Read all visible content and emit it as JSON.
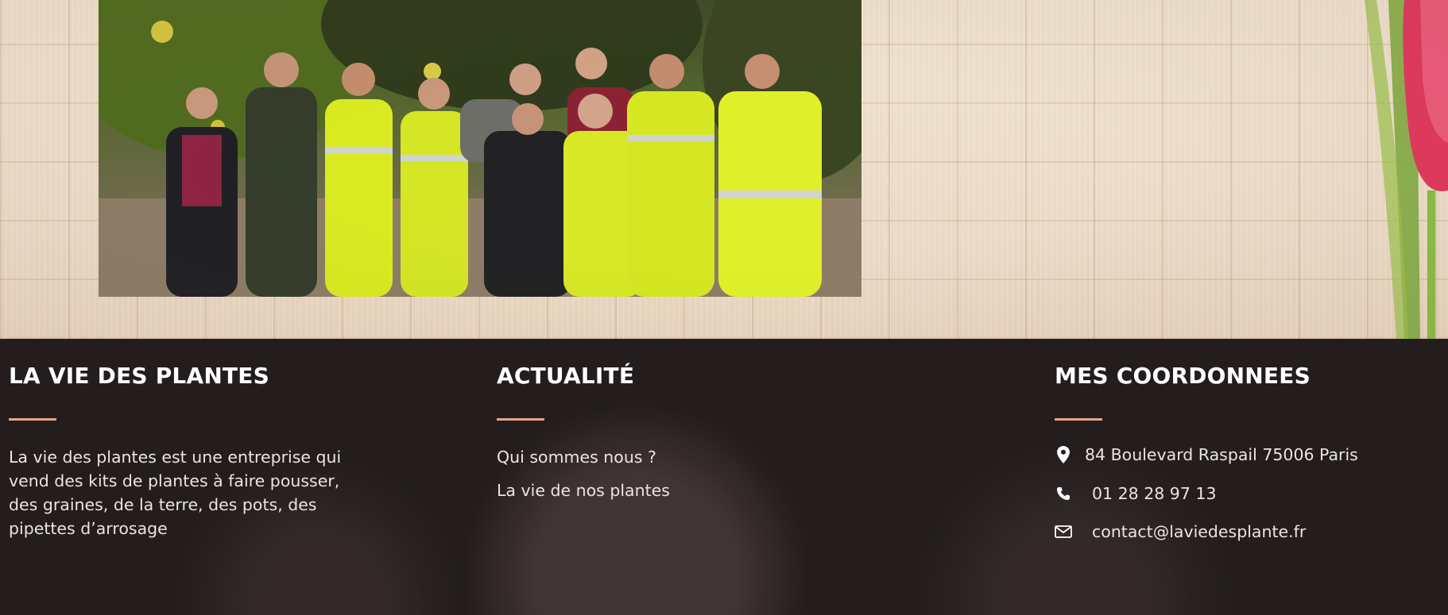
{
  "footer": {
    "about": {
      "title": "LA VIE DES PLANTES",
      "text": "La vie des plantes est une entreprise qui vend des kits de plantes à faire pousser, des graines, de la terre, des pots, des pipettes d’arrosage"
    },
    "news": {
      "title": "ACTUALITÉ",
      "links": [
        "Qui sommes nous ?",
        "La vie de nos plantes"
      ]
    },
    "contact": {
      "title": "MES COORDONNEES",
      "address": "84 Boulevard Raspail 75006 Paris",
      "phone": "01 28 28 97 13",
      "email": "contact@laviedesplante.fr"
    }
  },
  "icons": {
    "address": "map-pin-icon",
    "phone": "phone-icon",
    "email": "envelope-icon"
  },
  "colors": {
    "footer_background": "#231d1d",
    "accent_underline": "#e9a48c",
    "text": "#eae4e2"
  }
}
